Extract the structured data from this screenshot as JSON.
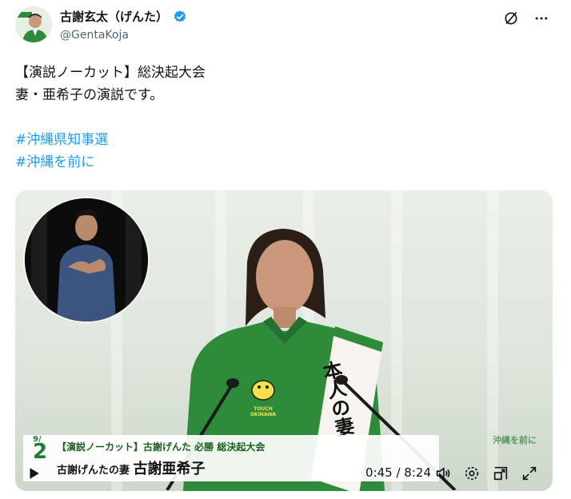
{
  "author": {
    "display_name": "古謝玄太（げんた）",
    "handle": "@GentaKoja"
  },
  "post": {
    "line1": "【演説ノーカット】総決起大会",
    "line2": "妻・亜希子の演説です。",
    "hashtag1": "#沖縄県知事選",
    "hashtag2": "#沖縄を前に"
  },
  "video": {
    "caption_number": "2",
    "caption_date_prefix": "9/",
    "caption_top": "【演説ノーカット】古謝げんた 必勝 総決起大会",
    "caption_bottom_prefix": "古謝げんたの妻 ",
    "caption_bottom_name": "古謝亜希子",
    "time_display": "0:45 / 8:24",
    "sash_text": "本人の妻",
    "shirt_text": "TOUCH OKINAWA",
    "background_sign": "沖縄を前に"
  },
  "icons": {
    "verified": "verified-badge-icon",
    "grok": "grok-icon",
    "more": "more-icon",
    "play": "play-icon",
    "volume": "volume-icon",
    "settings": "settings-icon",
    "pip": "picture-in-picture-icon",
    "fullscreen": "fullscreen-icon"
  },
  "colors": {
    "hashtag": "#1d9bf0",
    "verified": "#1d9bf0",
    "shirt": "#2e8b3a"
  }
}
